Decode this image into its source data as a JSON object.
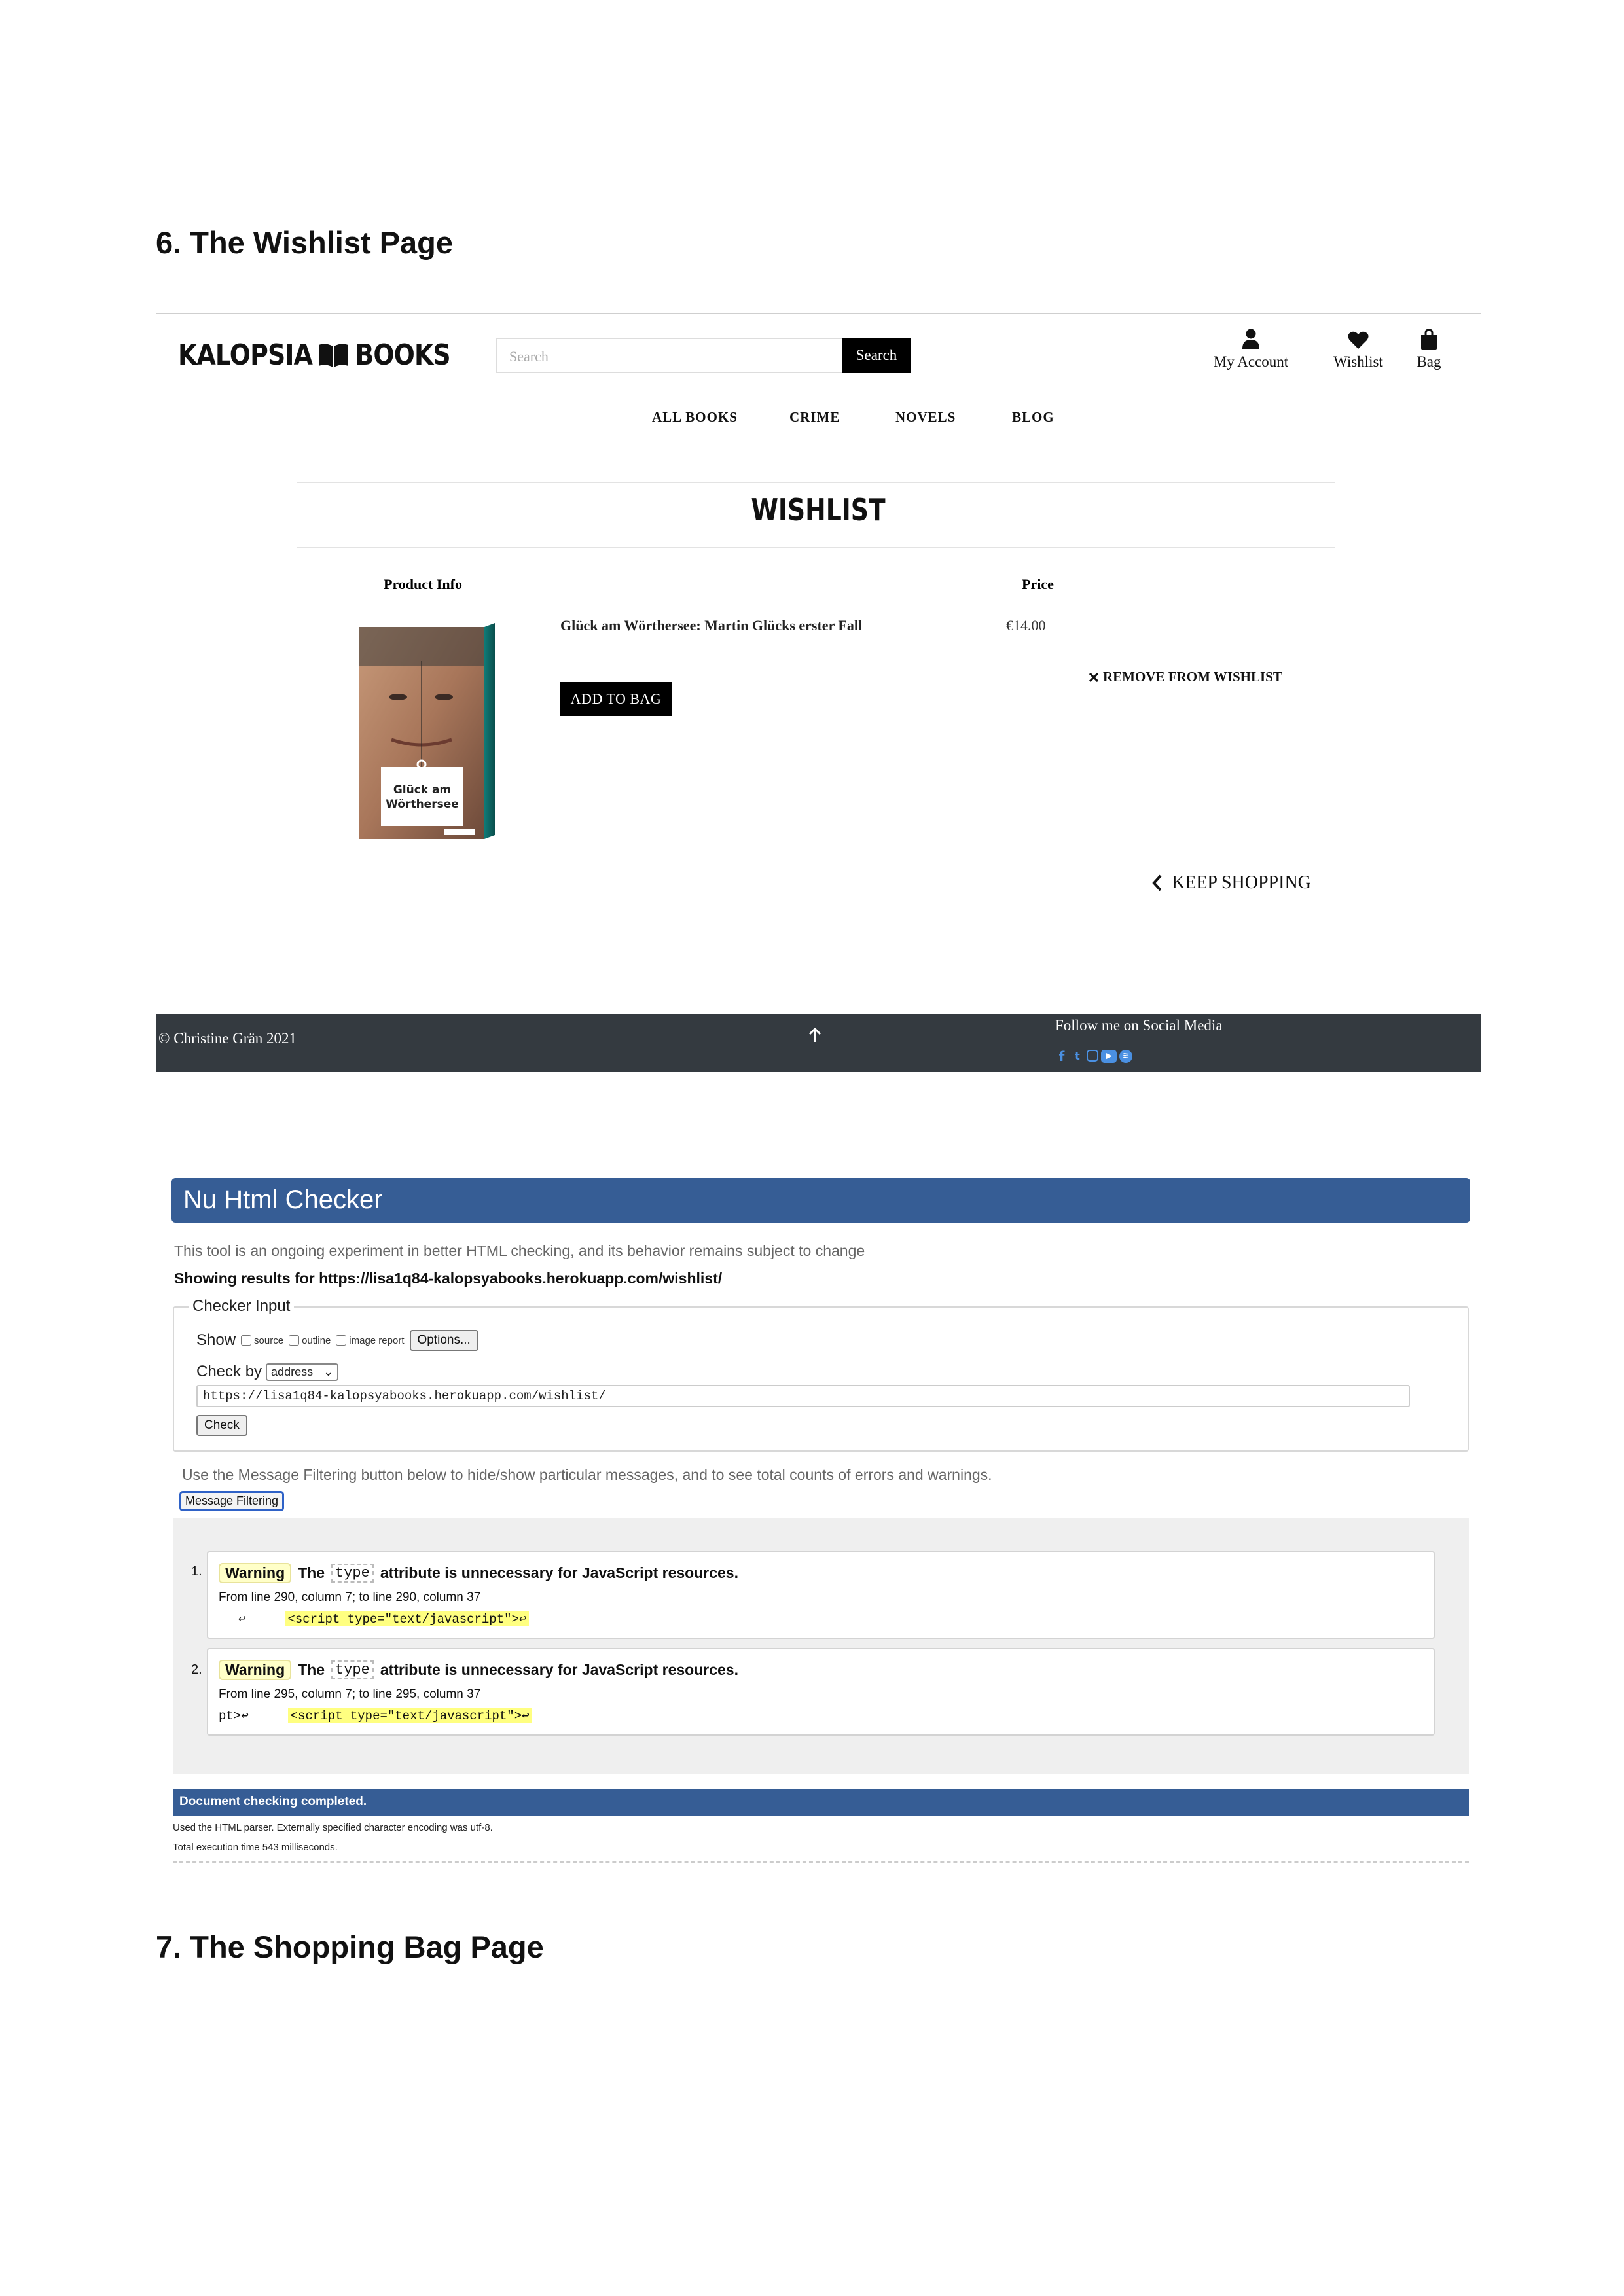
{
  "headings": {
    "wishlist_page": "6. The Wishlist Page",
    "bag_page": "7. The Shopping Bag Page"
  },
  "site": {
    "logo_left": "KALOPSIA",
    "logo_right": "BOOKS",
    "search_placeholder": "Search",
    "search_button": "Search",
    "header_links": [
      {
        "label": "My Account",
        "icon": "user-icon"
      },
      {
        "label": "Wishlist",
        "icon": "heart-icon"
      },
      {
        "label": "Bag",
        "icon": "shopping-bag-icon"
      }
    ],
    "nav": [
      "ALL BOOKS",
      "CRIME",
      "NOVELS",
      "BLOG"
    ],
    "page_title": "WISHLIST",
    "columns": {
      "product": "Product Info",
      "price": "Price"
    },
    "item": {
      "name": "Glück am Wörthersee: Martin Glücks erster Fall",
      "price": "€14.00",
      "add_to_bag": "ADD TO BAG",
      "remove": "REMOVE FROM WISHLIST",
      "cover_title": "Glück am Wörthersee"
    },
    "keep_shopping": "KEEP SHOPPING",
    "footer": {
      "copyright": "© Christine Grän 2021",
      "follow": "Follow me on Social Media",
      "social_icons": [
        "facebook-icon",
        "twitter-icon",
        "instagram-icon",
        "youtube-icon",
        "spotify-icon"
      ]
    },
    "colors": {
      "footer_bg": "#343a40",
      "social": "#4a90e2"
    }
  },
  "checker": {
    "title": "Nu Html Checker",
    "intro": "This tool is an ongoing experiment in better HTML checking, and its behavior remains subject to change",
    "results_for": "Showing results for https://lisa1q84-kalopsyabooks.herokuapp.com/wishlist/",
    "legend": "Checker Input",
    "show_label": "Show",
    "show_options": [
      "source",
      "outline",
      "image report"
    ],
    "options_button": "Options...",
    "check_by_label": "Check by",
    "check_by_value": "address",
    "url": "https://lisa1q84-kalopsyabooks.herokuapp.com/wishlist/",
    "check_button": "Check",
    "filter_hint": "Use the Message Filtering button below to hide/show particular messages, and to see total counts of errors and warnings.",
    "filter_button": "Message Filtering",
    "messages": [
      {
        "num": "1.",
        "badge": "Warning",
        "pre": "The",
        "code": "type",
        "post": "attribute is unnecessary for JavaScript resources.",
        "location": "From line 290, column 7; to line 290, column 37",
        "prefix": "↩",
        "snippet": "<script type=\"text/javascript\">↩"
      },
      {
        "num": "2.",
        "badge": "Warning",
        "pre": "The",
        "code": "type",
        "post": "attribute is unnecessary for JavaScript resources.",
        "location": "From line 295, column 7; to line 295, column 37",
        "prefix": "pt>↩",
        "snippet": "<script type=\"text/javascript\">↩"
      }
    ],
    "done": "Document checking completed.",
    "parser_note": "Used the HTML parser. Externally specified character encoding was utf-8.",
    "exec_time": "Total execution time 543 milliseconds.",
    "colors": {
      "bar": "#365d95",
      "warning_bg": "#ffffc8",
      "highlight": "#ffff80"
    }
  }
}
